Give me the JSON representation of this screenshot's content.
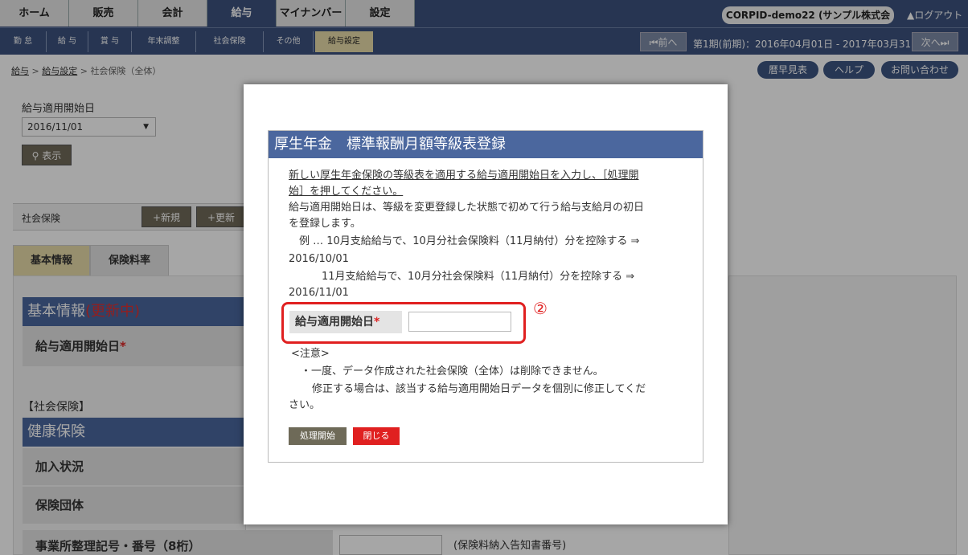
{
  "nav": {
    "tabs": [
      "ホーム",
      "販売",
      "会計",
      "給与",
      "マイナンバー",
      "設定"
    ],
    "company": "CORPID-demo22 (サンプル株式会社)",
    "logout": "ログアウト"
  },
  "subnav": {
    "tabs": [
      "勤 怠",
      "給 与",
      "賞 与",
      "年末調整",
      "社会保険",
      "その他",
      "給与設定"
    ],
    "prev": "前へ",
    "next": "次へ",
    "period": "第1期(前期)：2016年04月01日 - 2017年03月31日"
  },
  "breadcrumb": {
    "item1": "給与",
    "item2": "給与設定",
    "current": "社会保険（全体）"
  },
  "topbuttons": {
    "calendar": "暦早見表",
    "help": "ヘルプ",
    "contact": "お問い合わせ"
  },
  "filter": {
    "label": "給与適用開始日",
    "value": "2016/11/01",
    "show_button": "表示"
  },
  "section": {
    "label": "社会保険",
    "new_button": "新規",
    "update_button": "更新"
  },
  "tabs": {
    "basic": "基本情報",
    "premium": "保険料率"
  },
  "basic": {
    "header": "基本情報",
    "status": "(更新中)",
    "start_label": "給与適用開始日"
  },
  "social": {
    "bracket": "【社会保険】",
    "health_header": "健康保険",
    "rows": [
      "加入状況",
      "保険団体",
      "事業所整理記号・番号（8桁）"
    ],
    "note": "(保険料納入告知書番号)"
  },
  "dialog": {
    "title": "厚生年金　標準報酬月額等級表登録",
    "intro_line1": "新しい厚生年金保険の等級表を適用する給与適用開始日を入力し、［処理開",
    "intro_line2": "始］を押してください。",
    "desc_line1": "給与適用開始日は、等級を変更登録した状態で初めて行う給与支給月の初日",
    "desc_line2": "を登録します。",
    "ex_line1": "例 … 10月支給給与で、10月分社会保険料（11月納付）分を控除する ⇒",
    "ex_line2": "2016/10/01",
    "ex_line3": "11月支給給与で、10月分社会保険料（11月納付）分を控除する ⇒",
    "ex_line4": "2016/11/01",
    "field_label": "給与適用開始日",
    "field_value": "",
    "annotation": "②",
    "note_title": "<注意>",
    "note_line1": "・一度、データ作成された社会保険（全体）は削除できません。",
    "note_line2": "修正する場合は、該当する給与適用開始日データを個別に修正してくだ",
    "note_line3": "さい。",
    "start_button": "処理開始",
    "close_button": "閉じる"
  },
  "colors": {
    "nav": "#3c527e",
    "header_blue": "#4b679e",
    "active_subtab": "#e9dcaa",
    "close_red": "#e02020",
    "annotation": "#e02020"
  }
}
